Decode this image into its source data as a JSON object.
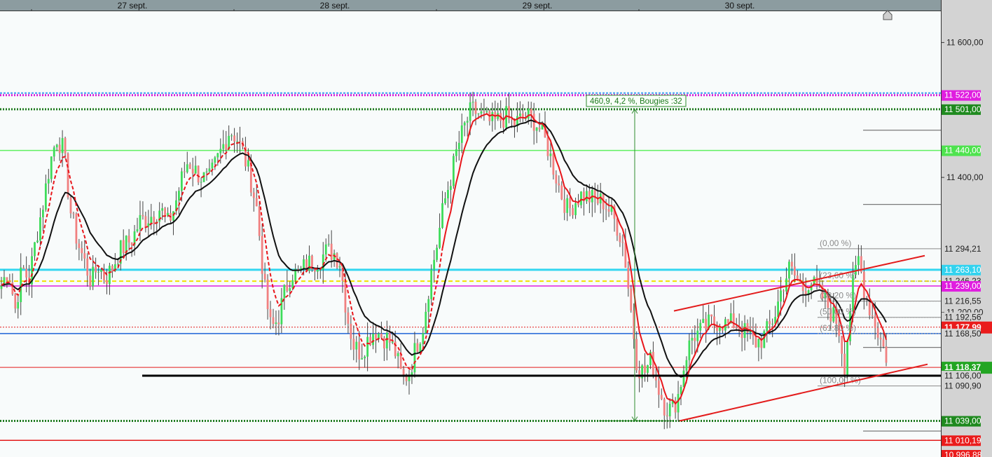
{
  "chart_data": {
    "type": "candlestick",
    "x_axis": {
      "date_labels": [
        "27 sept.",
        "28 sept.",
        "29 sept.",
        "30 sept."
      ]
    },
    "y_axis": {
      "ylim": [
        10985,
        11650
      ],
      "tick_labels": [
        {
          "value": 11600,
          "text": "11 600,00"
        },
        {
          "value": 11400,
          "text": "11 400,00"
        },
        {
          "value": 11200,
          "text": "11 200,00"
        }
      ]
    },
    "colors": {
      "up_candle": "#3ddc5a",
      "down_candle": "#f08080",
      "wick": "#444444",
      "ema_fast": "#e8161b",
      "ema_slow": "#111111",
      "background": "#f8fbfb",
      "axis_panel": "#d3d3d3",
      "date_bar": "#8c9ca0"
    },
    "price_path": [
      11240,
      11265,
      11205,
      11265,
      11248,
      11310,
      11360,
      11420,
      11460,
      11440,
      11350,
      11305,
      11275,
      11245,
      11270,
      11250,
      11265,
      11290,
      11300,
      11310,
      11335,
      11340,
      11345,
      11355,
      11330,
      11355,
      11395,
      11425,
      11410,
      11400,
      11395,
      11420,
      11445,
      11470,
      11460,
      11435,
      11400,
      11350,
      11240,
      11175,
      11190,
      11230,
      11260,
      11255,
      11270,
      11275,
      11278,
      11290,
      11290,
      11275,
      11195,
      11150,
      11140,
      11160,
      11175,
      11165,
      11160,
      11140,
      11100,
      11110,
      11150,
      11180,
      11250,
      11300,
      11360,
      11400,
      11445,
      11475,
      11500,
      11495,
      11485,
      11480,
      11485,
      11490,
      11478,
      11485,
      11490,
      11485,
      11470,
      11445,
      11410,
      11375,
      11350,
      11365,
      11375,
      11370,
      11365,
      11365,
      11350,
      11330,
      11300,
      11210,
      11120,
      11110,
      11130,
      11090,
      11060,
      11055,
      11080,
      11135,
      11165,
      11170,
      11180,
      11185,
      11188,
      11180,
      11185,
      11175,
      11165,
      11155,
      11160,
      11175,
      11200,
      11240,
      11265,
      11250,
      11235,
      11248,
      11230,
      11220,
      11200,
      11185,
      11120,
      11230,
      11280,
      11225,
      11195,
      11165,
      11135
    ],
    "moving_averages": [
      {
        "name": "EMA fast",
        "style": "dashed-then-solid",
        "color": "#e8161b"
      },
      {
        "name": "EMA slow",
        "style": "solid",
        "color": "#111111"
      }
    ],
    "horizontal_levels": [
      {
        "value": 11522.0,
        "label": "11 522,00",
        "style": "dotted",
        "line_color": "#d81bd8",
        "label_bg": "#e01ee0",
        "label_fg": "#ffffff"
      },
      {
        "value": 11501.0,
        "label": "11 501,00",
        "style": "dotted-thick",
        "line_color": "#1e7a1e",
        "label_bg": "#1f8a1f",
        "label_fg": "#ffffff"
      },
      {
        "value": 11440.0,
        "label": "11 440,00",
        "style": "solid",
        "line_color": "#5ff05f",
        "label_bg": "#4ee34e",
        "label_fg": "#ffffff"
      },
      {
        "value": 11294.21,
        "label": "11 294,21",
        "style": "fib",
        "line_color": "#8a8a8a",
        "label_bg": "#d3d3d3",
        "label_fg": "#222222"
      },
      {
        "value": 11263.1,
        "label": "11 263,10",
        "style": "solid-thick",
        "line_color": "#33d6f0",
        "label_bg": "#33d3ef",
        "label_fg": "#ffffff"
      },
      {
        "value": 11246.23,
        "label": "11 246,23",
        "style": "dashed",
        "line_color": "#f2df00",
        "label_bg": "#d3d3d3",
        "label_fg": "#222222"
      },
      {
        "value": 11239.0,
        "label": "11 239,00",
        "style": "solid",
        "line_color": "#e01ee0",
        "label_bg": "#e01ee0",
        "label_fg": "#ffffff"
      },
      {
        "value": 11216.55,
        "label": "11 216,55",
        "style": "fib",
        "line_color": "#8a8a8a",
        "label_bg": "#d3d3d3",
        "label_fg": "#222222"
      },
      {
        "value": 11192.56,
        "label": "11 192,56",
        "style": "fib",
        "line_color": "#8a8a8a",
        "label_bg": "#d3d3d3",
        "label_fg": "#222222"
      },
      {
        "value": 11177.99,
        "label": "11 177,99",
        "style": "dotted-thin",
        "line_color": "#e31b1b",
        "label_bg": "#ea1c1c",
        "label_fg": "#ffffff"
      },
      {
        "value": 11168.5,
        "label": "11 168,50",
        "style": "solid",
        "line_color": "#1f64d8",
        "label_bg": "#d3d3d3",
        "label_fg": "#222222"
      },
      {
        "value": 11118.37,
        "label": "11 118,37",
        "style": "solid-thin",
        "line_color": "#e31b1b",
        "label_bg": "#22a522",
        "label_fg": "#ffffff"
      },
      {
        "value": 11106.0,
        "label": "11 106,00",
        "style": "solid-thick",
        "line_color": "#000000",
        "label_bg": "#d3d3d3",
        "label_fg": "#222222"
      },
      {
        "value": 11090.9,
        "label": "11 090,90",
        "style": "fib",
        "line_color": "#8a8a8a",
        "label_bg": "#d3d3d3",
        "label_fg": "#222222"
      },
      {
        "value": 11039.0,
        "label": "11 039,00",
        "style": "dotted-thick",
        "line_color": "#1e7a1e",
        "label_bg": "#1f8a1f",
        "label_fg": "#ffffff"
      },
      {
        "value": 11010.19,
        "label": "11 010,19",
        "style": "solid",
        "line_color": "#e31b1b",
        "label_bg": "#ea1c1c",
        "label_fg": "#ffffff"
      },
      {
        "value": 10996.88,
        "label": "10 996,88",
        "style": "none",
        "line_color": "#e31b1b",
        "label_bg": "#ea1c1c",
        "label_fg": "#ffffff"
      }
    ],
    "fibonacci": {
      "high": 11294.21,
      "low": 11090.9,
      "labels": [
        "(0,00 %)",
        "(23,60 %)",
        "(38,20 %)",
        "(50,00 %)",
        "(61,80 %)",
        "(100,00 %)"
      ]
    },
    "measure_annotation": {
      "text": "460,9, 4,2 %, Bougies :32",
      "from_value": 11039.0,
      "to_value": 11501.0
    },
    "trend_channel": {
      "upper": [
        [
          11202
        ],
        [
          11284
        ]
      ],
      "lower": [
        [
          11039
        ],
        [
          11123
        ]
      ]
    }
  }
}
